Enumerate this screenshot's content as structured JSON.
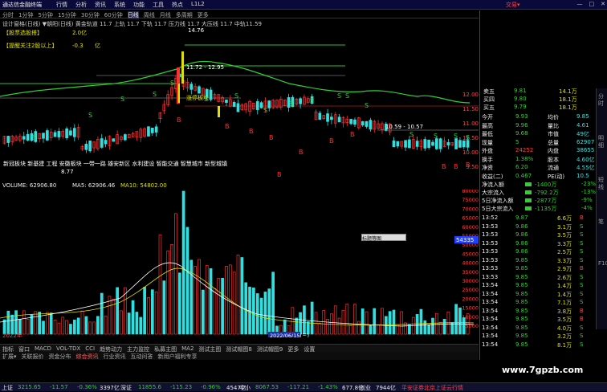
{
  "titlebar": {
    "title": "通达信金融终端",
    "menu": [
      "行情",
      "分析",
      "资讯",
      "系统",
      "功能",
      "工具",
      "热点",
      "L1L2"
    ],
    "account": "交易▾",
    "winbtns": [
      "—",
      "□",
      "✕"
    ]
  },
  "toolbar": {
    "periods": [
      "分时",
      "1分钟",
      "5分钟",
      "15分钟",
      "30分钟",
      "60分钟",
      "日线",
      "周线",
      "月线",
      "多周期",
      "更多"
    ],
    "active": 6
  },
  "infobar": {
    "text": "设计窗格(日线)  ▼朝阳(日线)  黄金轨道  11.7  上轨 11.7  下轨 11.7  压力线 11.7  大压线 11.7  中轨11.59"
  },
  "chart": {
    "price_labels": [
      "12.00",
      "11.50",
      "11.00",
      "10.50",
      "10.00",
      "9.50"
    ],
    "annot_top": "14.76",
    "annot_mid1": "11.72 - 12.95",
    "annot_mid2": "10.59 - 10.57",
    "annot_low": "8.77",
    "label_box1": "【股票选股搭】",
    "label_box2": "【提醒关注2股以上】",
    "val1": "2.0亿",
    "val2": "-0.3",
    "val3": "亿",
    "yellow_label": "涨停板块",
    "sector_text": "新冠板块   新基建  工程  安徽板块  一带一路  雄安新区  水利建设  智能交通  智慧城市  新型城镇"
  },
  "volhdr": {
    "vol": "VOLUME: 62906.80",
    "ma5": "MA5: 62906.46",
    "ma10": "MA10: 54802.00"
  },
  "vol_labels": [
    "80000",
    "75000",
    "70000",
    "65000",
    "60000",
    "55000",
    "50000",
    "45000",
    "40000",
    "35000",
    "30000",
    "25000",
    "20000",
    "15000",
    "10000",
    "5000"
  ],
  "vol_marker": "54335",
  "date_left": "2022年",
  "date_right": "2022/06/15(三)",
  "bottomtabs": [
    "指标",
    "窗口",
    "MACD",
    "VOL-TDX",
    "CCI",
    "趋势动力",
    "主力监控",
    "私募主图",
    "MA2",
    "测试主图",
    "测试帽图8",
    "测试帽图9",
    "更多",
    "设置"
  ],
  "bottomtabs2": [
    "扩展▾",
    "关联报价",
    "资金分布",
    "综合资讯",
    "行业资讯",
    "互动问答",
    "新用户福利专享"
  ],
  "rightpanel": {
    "asks": [
      [
        "卖五",
        "9.81",
        "14.1万"
      ],
      [
        "买四",
        "9.80",
        "18.1万"
      ],
      [
        "买五",
        "9.79",
        "18.1万"
      ]
    ],
    "stats": [
      [
        "今开",
        "9.93",
        "均价",
        "9.85"
      ],
      [
        "最高",
        "9.96",
        "量比",
        "4.61"
      ],
      [
        "最低",
        "9.68",
        "市值",
        "49亿"
      ],
      [
        "现量",
        "5",
        "总量",
        "62907"
      ],
      [
        "外盘",
        "24252",
        "内盘",
        "38655"
      ],
      [
        "换手",
        "1.38%",
        "股本",
        "4.60亿"
      ],
      [
        "净资",
        "6.20",
        "流通",
        "4.55亿"
      ],
      [
        "收益(二)",
        "0.467",
        "PE(动)",
        "10.5"
      ]
    ],
    "flows": [
      [
        "净流入额",
        "-1400万",
        "-23%"
      ],
      [
        "大宗流入",
        "-792.2万",
        "-13%"
      ],
      [
        "5日净流入额",
        "-2877万",
        "-9%"
      ],
      [
        "5日大宗流入",
        "-1135万",
        "-4%"
      ]
    ],
    "trades": [
      [
        "13:52",
        "9.87",
        "6.6万",
        "B"
      ],
      [
        "13:53",
        "9.86",
        "3.1万",
        "S"
      ],
      [
        "13:53",
        "9.86",
        "3.5万",
        "S"
      ],
      [
        "13:53",
        "9.86",
        "3.3万",
        "S"
      ],
      [
        "13:53",
        "9.86",
        "2.5万",
        "S"
      ],
      [
        "13:53",
        "9.85",
        "3.3万",
        "S"
      ],
      [
        "13:53",
        "9.85",
        "2.9万",
        "B"
      ],
      [
        "13:53",
        "9.85",
        "2.6万",
        "S"
      ],
      [
        "13:54",
        "9.85",
        "1.4万",
        "S"
      ],
      [
        "13:54",
        "9.85",
        "1.4万",
        "S"
      ],
      [
        "13:54",
        "9.85",
        "7.1万",
        "S"
      ],
      [
        "13:54",
        "9.85",
        "3.8万",
        "B"
      ],
      [
        "13:54",
        "9.85",
        "3.5万",
        "B"
      ],
      [
        "13:54",
        "9.85",
        "4.0万",
        "S"
      ],
      [
        "13:54",
        "9.85",
        "3.2万",
        "S"
      ],
      [
        "13:54",
        "9.85",
        "8.1万",
        "S"
      ]
    ]
  },
  "sidebar": [
    "分时",
    "明细",
    "短线",
    "笔",
    "F10"
  ],
  "popup": "标题等图",
  "status": [
    [
      "上证",
      "3215.65",
      "-11.57",
      "-0.36%",
      "3397亿"
    ],
    [
      "深证",
      "11855.6",
      "-115.23",
      "-0.96%",
      "4547亿"
    ],
    [
      "中小",
      "8067.53",
      "-117.21",
      "-1.43%",
      "677.8亿"
    ],
    [
      "创业",
      "7944亿",
      ""
    ]
  ],
  "broker": "平安证券北京上证云行情",
  "watermark": "www.7gpzb.com",
  "chart_points": [
    [
      "9.9",
      "10.4"
    ],
    [
      "10.0",
      "10.5"
    ]
  ]
}
